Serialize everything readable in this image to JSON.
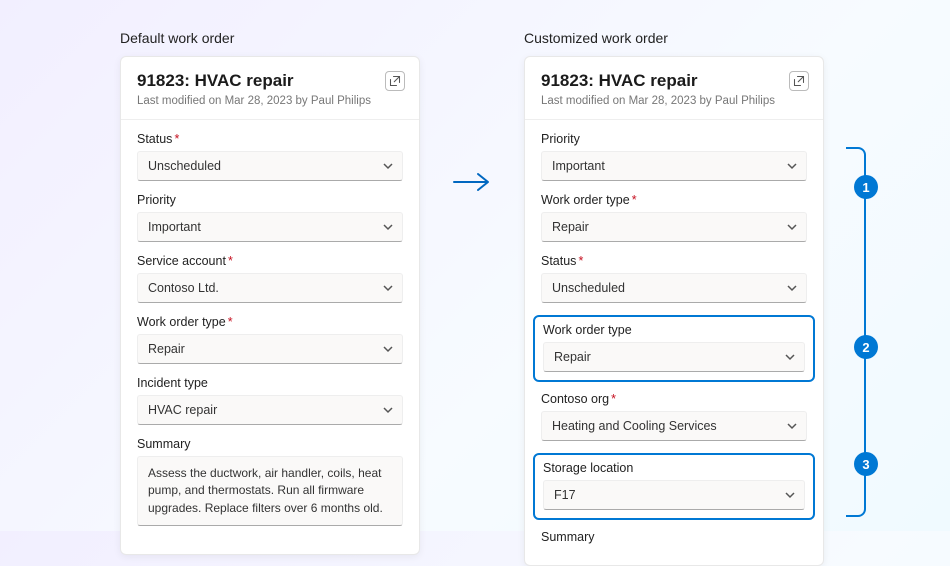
{
  "leftTitle": "Default work order",
  "rightTitle": "Customized work order",
  "callouts": {
    "n1": "1",
    "n2": "2",
    "n3": "3"
  },
  "left": {
    "title": "91823: HVAC repair",
    "subtitle": "Last modified on Mar 28, 2023 by Paul Philips",
    "fields": {
      "status": {
        "label": "Status",
        "required": true,
        "value": "Unscheduled"
      },
      "priority": {
        "label": "Priority",
        "required": false,
        "value": "Important"
      },
      "serviceAccount": {
        "label": "Service account",
        "required": true,
        "value": "Contoso Ltd."
      },
      "workOrderType": {
        "label": "Work order type",
        "required": true,
        "value": "Repair"
      },
      "incidentType": {
        "label": "Incident type",
        "required": false,
        "value": "HVAC repair"
      },
      "summary": {
        "label": "Summary",
        "value": "Assess the ductwork, air handler, coils, heat pump, and thermostats. Run all firmware upgrades. Replace filters over 6 months old."
      }
    }
  },
  "right": {
    "title": "91823: HVAC repair",
    "subtitle": "Last modified on Mar 28, 2023 by Paul Philips",
    "fields": {
      "priority": {
        "label": "Priority",
        "required": false,
        "value": "Important"
      },
      "workOrderTypeReq": {
        "label": "Work order type",
        "required": true,
        "value": "Repair"
      },
      "status": {
        "label": "Status",
        "required": true,
        "value": "Unscheduled"
      },
      "workOrderType": {
        "label": "Work order type",
        "required": false,
        "value": "Repair"
      },
      "contosoOrg": {
        "label": "Contoso org",
        "required": true,
        "value": "Heating and Cooling Services"
      },
      "storageLocation": {
        "label": "Storage location",
        "required": false,
        "value": "F17"
      },
      "summary": {
        "label": "Summary",
        "value": ""
      }
    }
  }
}
